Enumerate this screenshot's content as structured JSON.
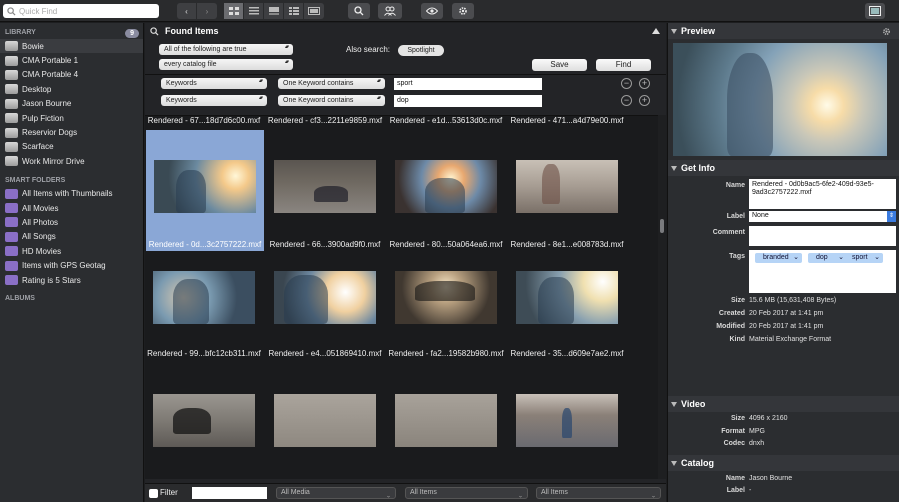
{
  "toolbar": {
    "search_placeholder": "Quick Find",
    "icons": [
      "back-icon",
      "forward-icon",
      "grid-view-icon",
      "list-view-icon",
      "filmstrip-view-icon",
      "columns-view-icon",
      "viewer-icon",
      "find-icon",
      "people-icon",
      "preview-eye-icon",
      "gear-icon",
      "panel-icon"
    ]
  },
  "sidebar": {
    "library_title": "LIBRARY",
    "library_count": "9",
    "library_items": [
      {
        "label": "Bowie",
        "selected": true
      },
      {
        "label": "CMA Portable 1"
      },
      {
        "label": "CMA Portable 4"
      },
      {
        "label": "Desktop"
      },
      {
        "label": "Jason Bourne"
      },
      {
        "label": "Pulp Fiction"
      },
      {
        "label": "Reservior Dogs"
      },
      {
        "label": "Scarface"
      },
      {
        "label": "Work Mirror Drive"
      }
    ],
    "smart_title": "SMART FOLDERS",
    "smart_items": [
      {
        "label": "All Items with Thumbnails"
      },
      {
        "label": "All Movies"
      },
      {
        "label": "All Photos"
      },
      {
        "label": "All Songs"
      },
      {
        "label": "HD Movies"
      },
      {
        "label": "Items with GPS Geotag"
      },
      {
        "label": "Rating is 5 Stars"
      }
    ],
    "albums_title": "ALBUMS"
  },
  "center": {
    "title": "Found Items",
    "match_mode": "All of the following are true",
    "scope": "every catalog file",
    "also_search_label": "Also search:",
    "also_search_value": "Spotlight",
    "save_label": "Save",
    "find_label": "Find",
    "rules": [
      {
        "field": "Keywords",
        "op": "One Keyword contains",
        "value": "sport"
      },
      {
        "field": "Keywords",
        "op": "One Keyword contains",
        "value": "dop"
      }
    ],
    "items": [
      {
        "caption": "Rendered - 67...18d7d6c00.mxf"
      },
      {
        "caption": "Rendered - cf3...2211e9859.mxf"
      },
      {
        "caption": "Rendered - e1d...53613d0c.mxf"
      },
      {
        "caption": "Rendered - 471...a4d79e00.mxf"
      },
      {
        "caption": "Rendered - 0d...3c2757222.mxf",
        "selected": true
      },
      {
        "caption": "Rendered - 66...3900ad9f0.mxf"
      },
      {
        "caption": "Rendered - 80...50a064ea6.mxf"
      },
      {
        "caption": "Rendered - 8e1...e008783d.mxf"
      },
      {
        "caption": "Rendered - 99...bfc12cb311.mxf"
      },
      {
        "caption": "Rendered - e4...051869410.mxf"
      },
      {
        "caption": "Rendered - fa2...19582b980.mxf"
      },
      {
        "caption": "Rendered - 35...d609e7ae2.mxf"
      }
    ],
    "footer": {
      "filter_label": "Filter",
      "filter_value": "",
      "media_select": "All Media",
      "items_select_1": "All Items",
      "items_select_2": "All Items"
    }
  },
  "right": {
    "preview_title": "Preview",
    "getinfo_title": "Get Info",
    "name_label": "Name",
    "name_value": "Rendered - 0d0b9ac5-6fe2-409d-93e5-9ad3c2757222.mxf",
    "label_label": "Label",
    "label_value": "None",
    "comment_label": "Comment",
    "comment_value": "",
    "tags_label": "Tags",
    "tags": [
      "branded",
      "dop",
      "sport"
    ],
    "size_label": "Size",
    "size_value": "15.6 MB (15,631,408 Bytes)",
    "created_label": "Created",
    "created_value": "20 Feb 2017 at 1:41 pm",
    "modified_label": "Modified",
    "modified_value": "20 Feb 2017 at 1:41 pm",
    "kind_label": "Kind",
    "kind_value": "Material Exchange Format",
    "video_title": "Video",
    "vsize_label": "Size",
    "vsize_value": "4096 x 2160",
    "format_label": "Format",
    "format_value": "MPG",
    "codec_label": "Codec",
    "codec_value": "dnxh",
    "catalog_title": "Catalog",
    "cname_label": "Name",
    "cname_value": "Jason Bourne",
    "clabel_label": "Label",
    "clabel_value": "-"
  }
}
